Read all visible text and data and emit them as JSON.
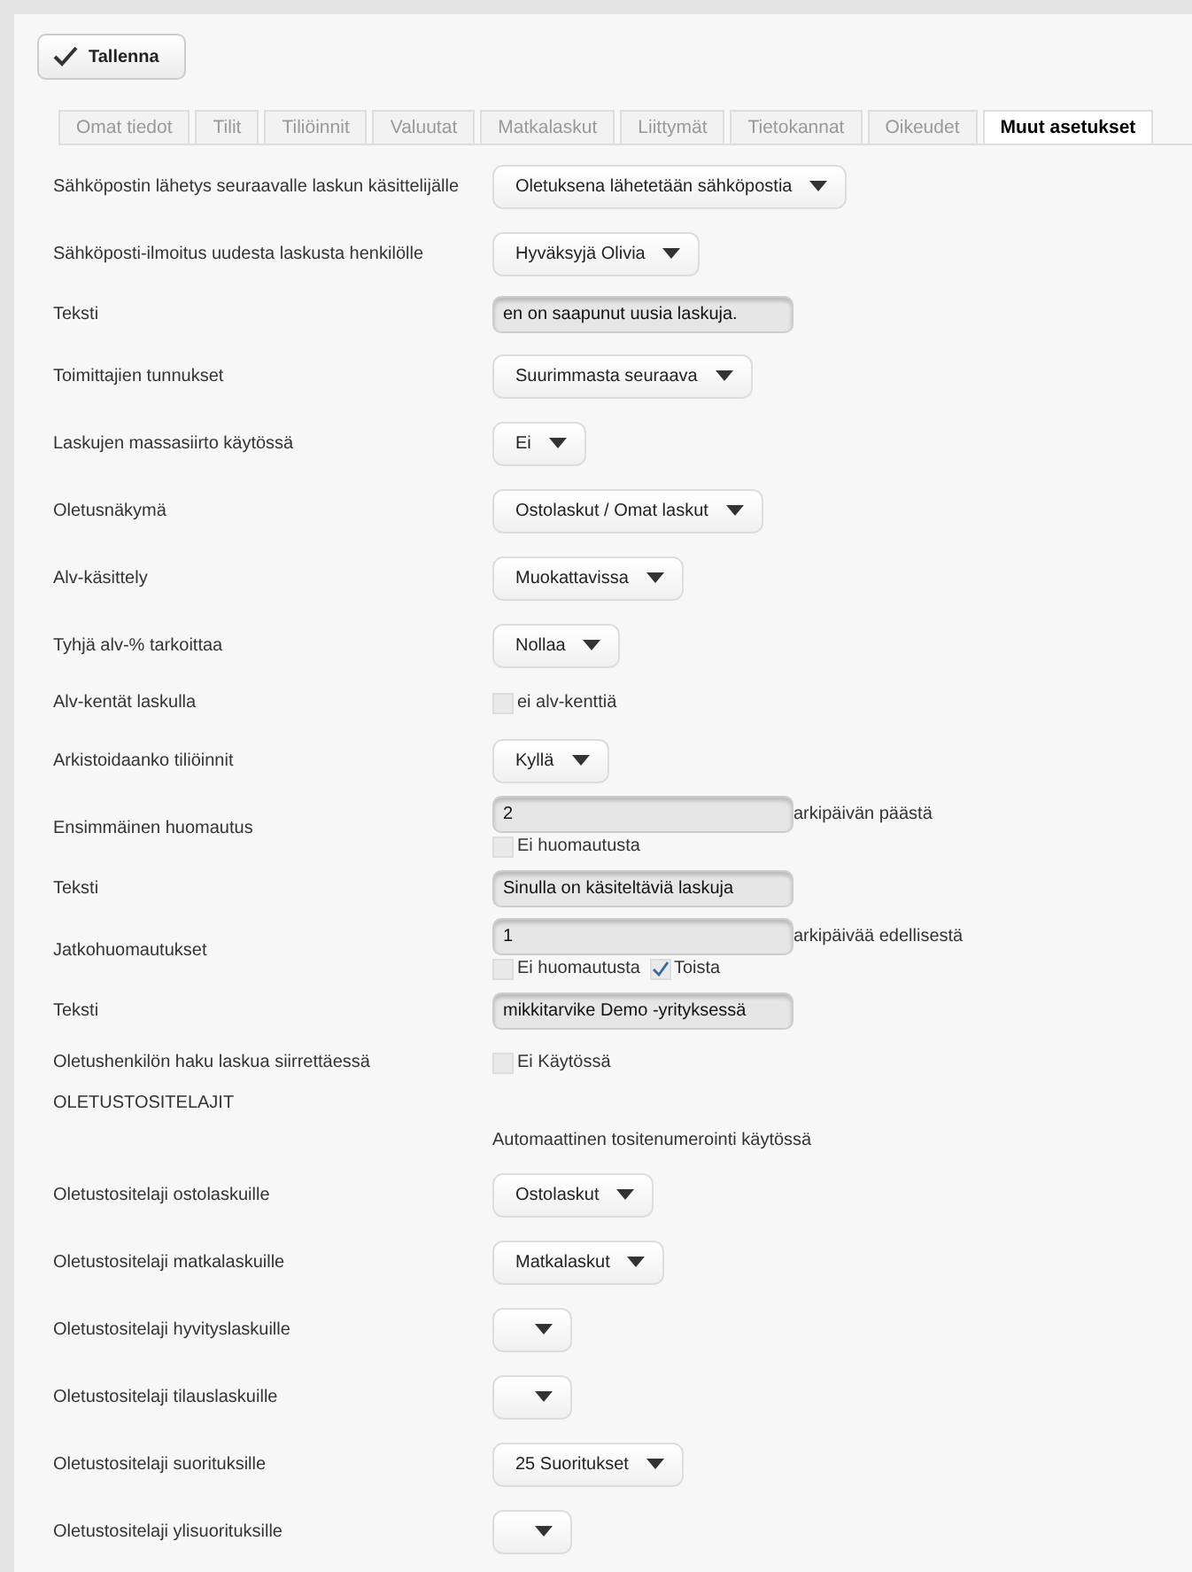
{
  "save_button": {
    "label": "Tallenna"
  },
  "tabs": [
    {
      "label": "Omat tiedot",
      "selected": false
    },
    {
      "label": "Tilit",
      "selected": false
    },
    {
      "label": "Tiliöinnit",
      "selected": false
    },
    {
      "label": "Valuutat",
      "selected": false
    },
    {
      "label": "Matkalaskut",
      "selected": false
    },
    {
      "label": "Liittymät",
      "selected": false
    },
    {
      "label": "Tietokannat",
      "selected": false
    },
    {
      "label": "Oikeudet",
      "selected": false
    },
    {
      "label": "Muut asetukset",
      "selected": true
    }
  ],
  "settings": [
    {
      "kind": "select",
      "label": "Sähköpostin lähetys seuraavalle laskun käsittelijälle",
      "value": "Oletuksena lähetetään sähköpostia"
    },
    {
      "kind": "select",
      "label": "Sähköposti-ilmoitus uudesta laskusta henkilölle",
      "value": "Hyväksyjä Olivia"
    },
    {
      "kind": "input",
      "label": "Teksti",
      "value": "en on saapunut uusia laskuja."
    },
    {
      "kind": "select",
      "label": "Toimittajien tunnukset",
      "value": "Suurimmasta seuraava"
    },
    {
      "kind": "select",
      "label": "Laskujen massasiirto käytössä",
      "value": "Ei"
    },
    {
      "kind": "select",
      "label": "Oletusnäkymä",
      "value": "Ostolaskut / Omat laskut"
    },
    {
      "kind": "select",
      "label": "Alv-käsittely",
      "value": "Muokattavissa"
    },
    {
      "kind": "select",
      "label": "Tyhjä alv-% tarkoittaa",
      "value": "Nollaa"
    },
    {
      "kind": "check",
      "label": "Alv-kentät laskulla",
      "checks": [
        {
          "label": "ei alv-kenttiä",
          "checked": false
        }
      ]
    },
    {
      "kind": "select",
      "label": "Arkistoidaanko tiliöinnit",
      "value": "Kyllä"
    },
    {
      "kind": "number",
      "label": "Ensimmäinen huomautus",
      "value": "2",
      "suffix": "arkipäivän päästä",
      "checks": [
        {
          "label": "Ei huomautusta",
          "checked": false
        }
      ]
    },
    {
      "kind": "input",
      "label": "Teksti",
      "value": "Sinulla on käsiteltäviä laskuja"
    },
    {
      "kind": "number",
      "label": "Jatkohuomautukset",
      "value": "1",
      "suffix": "arkipäivää edellisestä",
      "checks": [
        {
          "label": "Ei huomautusta",
          "checked": false
        },
        {
          "label": "Toista",
          "checked": true
        }
      ]
    },
    {
      "kind": "input",
      "label": "Teksti",
      "value": "mikkitarvike Demo -yrityksessä"
    },
    {
      "kind": "check",
      "label": "Oletushenkilön haku laskua siirrettäessä",
      "checks": [
        {
          "label": "Ei Käytössä",
          "checked": false
        }
      ]
    },
    {
      "kind": "heading",
      "label": "OLETUSTOSITELAJIT"
    },
    {
      "kind": "note",
      "text": "Automaattinen tositenumerointi käytössä"
    },
    {
      "kind": "select",
      "label": "Oletustositelaji ostolaskuille",
      "value": "Ostolaskut"
    },
    {
      "kind": "select",
      "label": "Oletustositelaji matkalaskuille",
      "value": "Matkalaskut"
    },
    {
      "kind": "select",
      "label": "Oletustositelaji hyvityslaskuille"
    },
    {
      "kind": "select",
      "label": "Oletustositelaji tilauslaskuille"
    },
    {
      "kind": "select",
      "label": "Oletustositelaji suorituksille",
      "value": "25 Suoritukset"
    },
    {
      "kind": "select",
      "label": "Oletustositelaji ylisuorituksille"
    }
  ]
}
